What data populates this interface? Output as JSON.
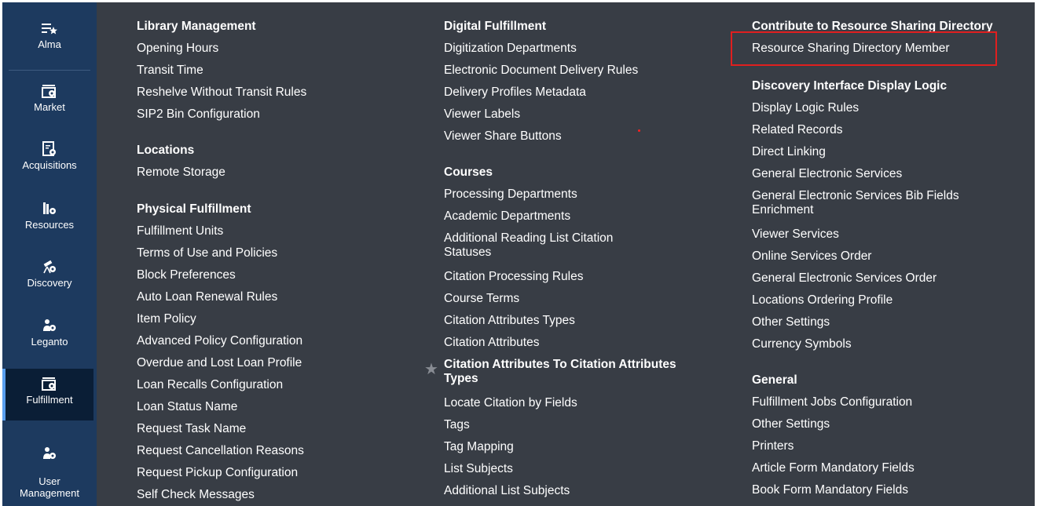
{
  "sidebar": {
    "items": [
      {
        "label": "Alma",
        "icon": "alma-star-menu-icon"
      },
      {
        "label": "Market",
        "icon": "market-settings-icon"
      },
      {
        "label": "Acquisitions",
        "icon": "acquisitions-settings-icon"
      },
      {
        "label": "Resources",
        "icon": "resources-settings-icon"
      },
      {
        "label": "Discovery",
        "icon": "discovery-settings-icon"
      },
      {
        "label": "Leganto",
        "icon": "leganto-settings-icon"
      },
      {
        "label": "Fulfillment",
        "icon": "fulfillment-settings-icon",
        "active": true
      },
      {
        "label": "User\nManagement",
        "icon": "user-management-settings-icon"
      }
    ],
    "colors": {
      "background": "#1d3a5f",
      "active": "#0a1e36",
      "active_indicator": "#5aa0f0"
    }
  },
  "panel": {
    "background": "#383d45",
    "columns": [
      {
        "sections": [
          {
            "heading": "Library Management",
            "items": [
              "Opening Hours",
              "Transit Time",
              "Reshelve Without Transit Rules",
              "SIP2 Bin Configuration"
            ]
          },
          {
            "heading": "Locations",
            "items": [
              "Remote Storage"
            ]
          },
          {
            "heading": "Physical Fulfillment",
            "items": [
              "Fulfillment Units",
              "Terms of Use and Policies",
              "Block Preferences",
              "Auto Loan Renewal Rules",
              "Item Policy",
              "Advanced Policy Configuration",
              "Overdue and Lost Loan Profile",
              "Loan Recalls Configuration",
              "Loan Status Name",
              "Request Task Name",
              "Request Cancellation Reasons",
              "Request Pickup Configuration",
              "Self Check Messages"
            ]
          }
        ]
      },
      {
        "sections": [
          {
            "heading": "Digital Fulfillment",
            "items": [
              "Digitization Departments",
              "Electronic Document Delivery Rules",
              "Delivery Profiles Metadata",
              "Viewer Labels",
              "Viewer Share Buttons"
            ]
          },
          {
            "heading": "Courses",
            "items": [
              "Processing Departments",
              "Academic Departments",
              "Additional Reading List Citation Statuses",
              "Citation Processing Rules",
              "Course Terms",
              "Citation Attributes Types",
              "Citation Attributes"
            ]
          },
          {
            "heading_like_item": "Citation Attributes To Citation Attributes Types",
            "items": [
              "Locate Citation by Fields",
              "Tags",
              "Tag Mapping",
              "List Subjects",
              "Additional List Subjects"
            ]
          }
        ]
      },
      {
        "sections": [
          {
            "heading": "Contribute to Resource Sharing Directory",
            "items": [
              "Resource Sharing Directory Member"
            ]
          },
          {
            "heading": "Discovery Interface Display Logic",
            "items": [
              "Display Logic Rules",
              "Related Records",
              "Direct Linking",
              "General Electronic Services",
              "General Electronic Services Bib Fields Enrichment",
              "Viewer Services",
              "Online Services Order",
              "General Electronic Services Order",
              "Locations Ordering Profile",
              "Other Settings",
              "Currency Symbols"
            ]
          },
          {
            "heading": "General",
            "items": [
              "Fulfillment Jobs Configuration",
              "Other Settings",
              "Printers",
              "Article Form Mandatory Fields",
              "Book Form Mandatory Fields"
            ]
          }
        ]
      }
    ],
    "highlight_color": "#e01f1f",
    "favorite_icon": "star-icon"
  }
}
